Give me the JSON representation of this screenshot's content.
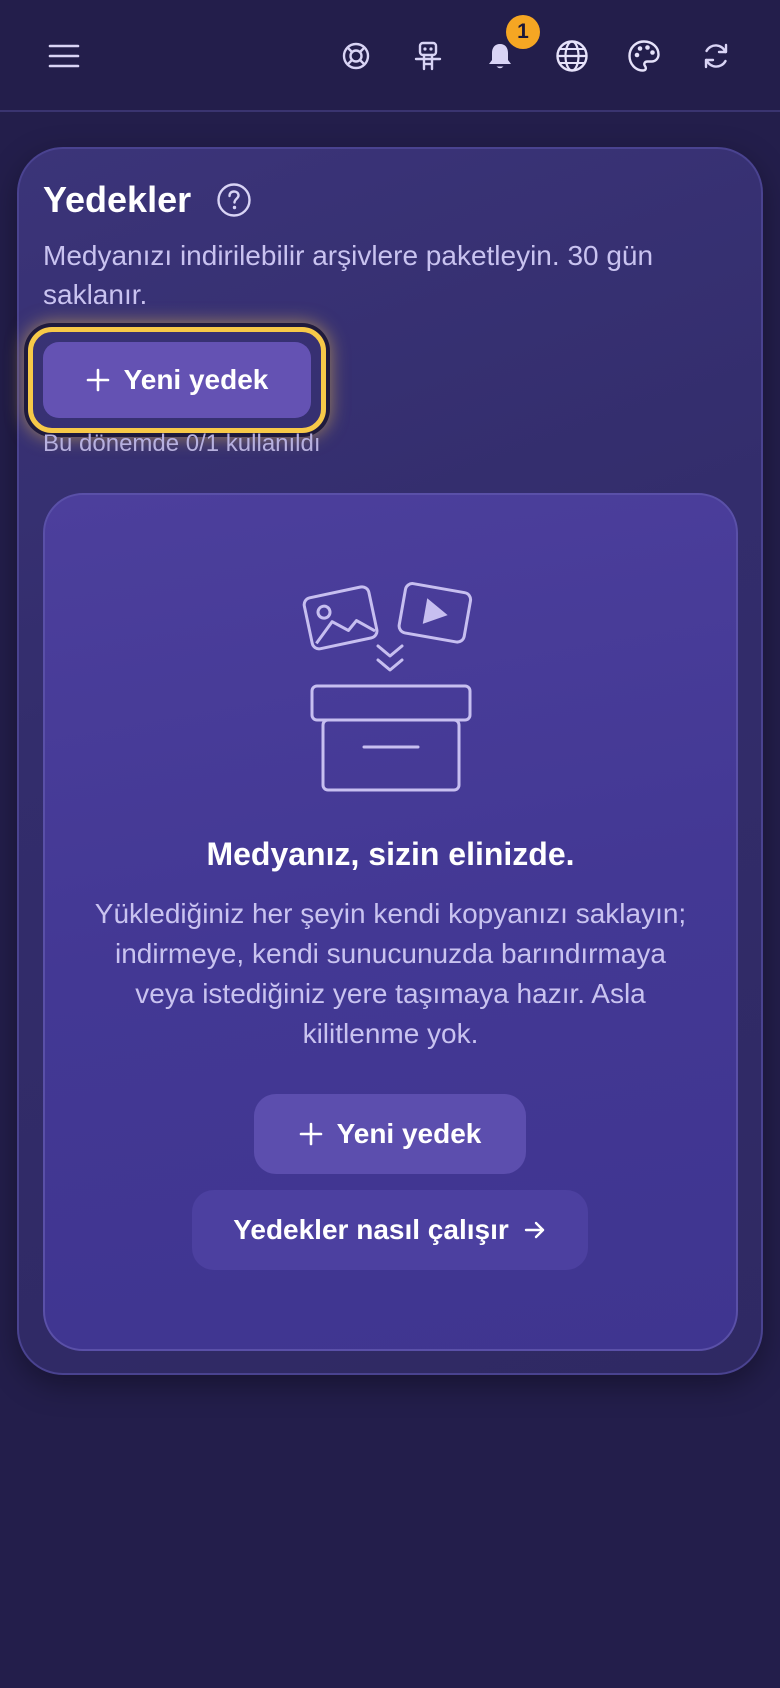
{
  "header": {
    "icons": [
      "menu-icon",
      "help-lifebuoy-icon",
      "robot-icon",
      "bell-icon",
      "globe-icon",
      "palette-icon",
      "refresh-icon"
    ],
    "notification_count": "1"
  },
  "page": {
    "title": "Yedekler",
    "subtitle": "Medyanızı indirilebilir arşivlere paketleyin. 30 gün saklanır.",
    "new_backup_label": "Yeni yedek",
    "usage_text": "Bu dönemde 0/1 kullanıldı"
  },
  "empty_state": {
    "title": "Medyanız, sizin elinizde.",
    "description": "Yüklediğiniz her şeyin kendi kopyanızı saklayın; indirmeye, kendi sunucunuzda barındırmaya veya istediğiniz yere taşımaya hazır. Asla kilitlenme yok.",
    "new_backup_label": "Yeni yedek",
    "how_it_works_label": "Yedekler nasıl çalışır"
  },
  "colors": {
    "background": "#231e4b",
    "primary_button": "#6452b3",
    "focus_ring": "#f7c948",
    "badge": "#f5a623"
  }
}
